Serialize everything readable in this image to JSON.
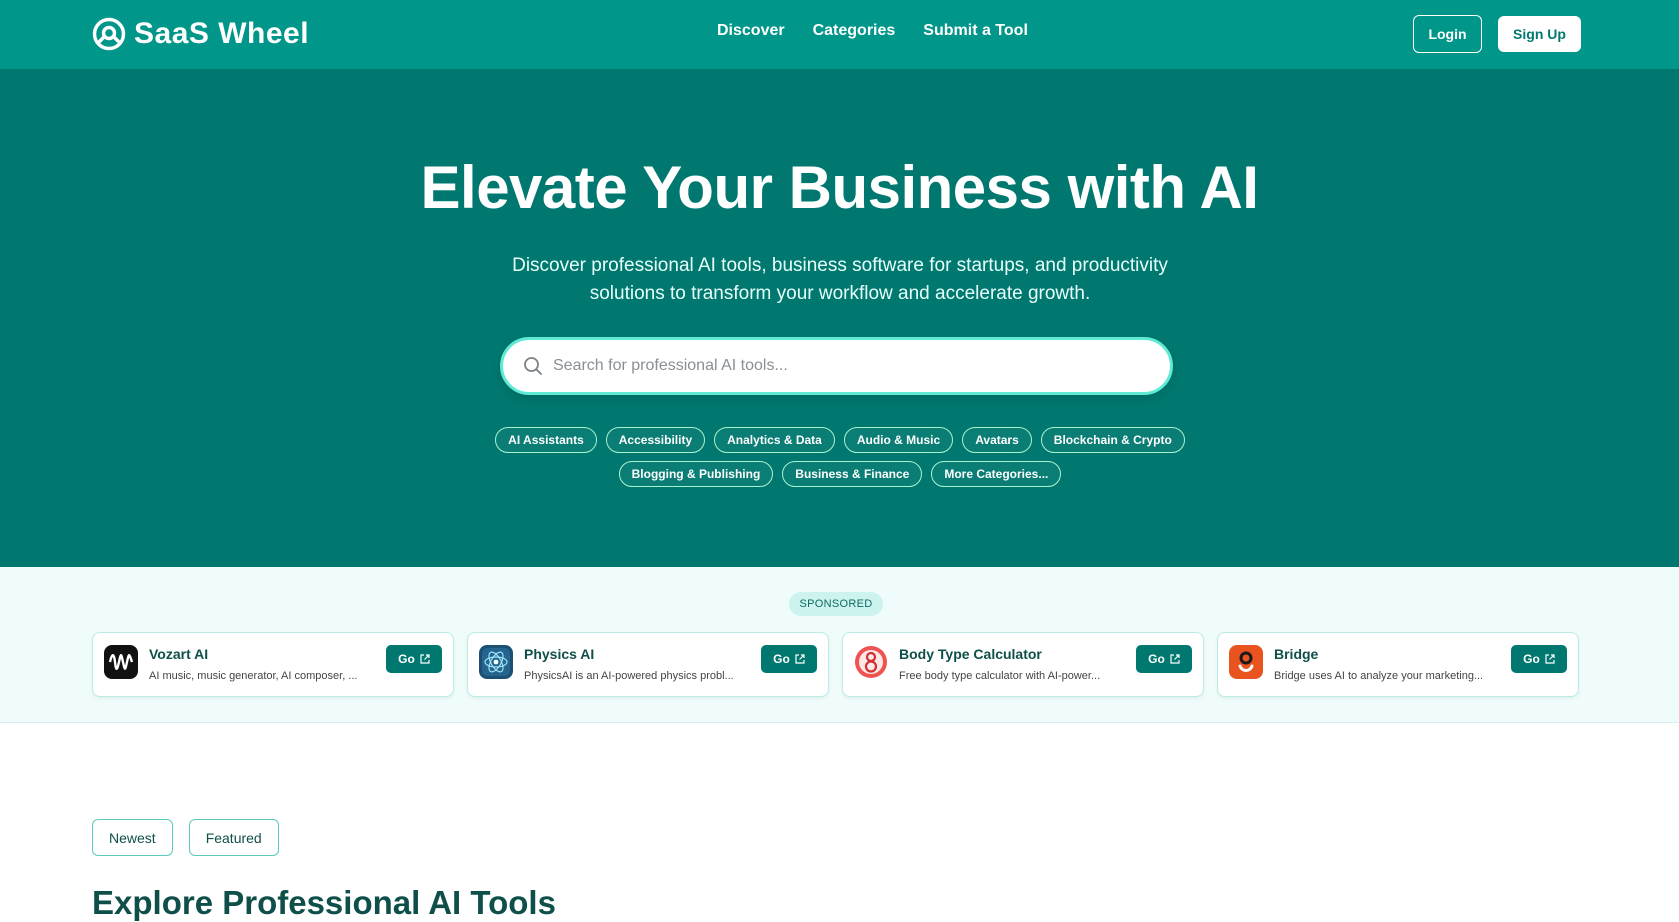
{
  "header": {
    "brand": "SaaS Wheel",
    "nav": [
      "Discover",
      "Categories",
      "Submit a Tool"
    ],
    "login": "Login",
    "signup": "Sign Up"
  },
  "hero": {
    "title": "Elevate Your Business with AI",
    "subtitle_line1": "Discover professional AI tools, business software for startups, and productivity",
    "subtitle_line2": "solutions to transform your workflow and accelerate growth.",
    "search_placeholder": "Search for professional AI tools...",
    "categories": [
      "AI Assistants",
      "Accessibility",
      "Analytics & Data",
      "Audio & Music",
      "Avatars",
      "Blockchain & Crypto",
      "Blogging & Publishing",
      "Business & Finance",
      "More Categories..."
    ]
  },
  "sponsored": {
    "badge": "SPONSORED",
    "go_label": "Go",
    "cards": [
      {
        "name": "Vozart AI",
        "desc": "AI music, music generator, AI composer, ...",
        "icon": "waveform-icon"
      },
      {
        "name": "Physics AI",
        "desc": "PhysicsAI is an AI-powered physics probl...",
        "icon": "physics-ai-icon"
      },
      {
        "name": "Body Type Calculator",
        "desc": "Free body type calculator with AI-power...",
        "icon": "body-icon"
      },
      {
        "name": "Bridge",
        "desc": "Bridge uses AI to analyze your marketing...",
        "icon": "bridge-icon"
      }
    ]
  },
  "tabs": [
    "Newest",
    "Featured"
  ],
  "section_title": "Explore Professional AI Tools",
  "colors": {
    "header": "#009689",
    "hero": "#00786f",
    "accent": "#00786f",
    "band": "#effcfb"
  }
}
